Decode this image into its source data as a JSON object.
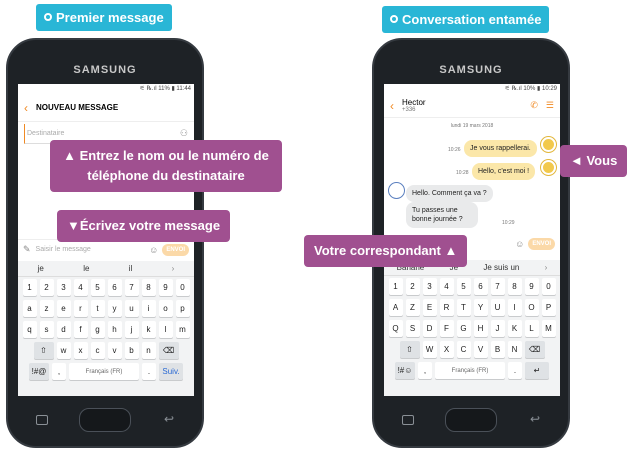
{
  "labels": {
    "first_message": "Premier message",
    "conversation_started": "Conversation entamée",
    "enter_name": "▲ Entrez le nom ou le numéro de téléphone du destinataire",
    "write_message": "▼Écrivez votre message",
    "you": "◄ Vous",
    "correspondent": "Votre correspondant ▲"
  },
  "phone_left": {
    "brand": "SAMSUNG",
    "status": "⚟ ℞.ıl 11% ▮ 11:44",
    "header_title": "NOUVEAU MESSAGE",
    "recipient_placeholder": "Destinataire",
    "input_placeholder": "Saisir le message",
    "send_label": "ENVOI",
    "suggestions": [
      "je",
      "le",
      "il"
    ],
    "keys_row0": [
      "1",
      "2",
      "3",
      "4",
      "5",
      "6",
      "7",
      "8",
      "9",
      "0"
    ],
    "keys_row1": [
      "a",
      "z",
      "e",
      "r",
      "t",
      "y",
      "u",
      "i",
      "o",
      "p"
    ],
    "keys_row2": [
      "q",
      "s",
      "d",
      "f",
      "g",
      "h",
      "j",
      "k",
      "l",
      "m"
    ],
    "keys_row3": [
      "w",
      "x",
      "c",
      "v",
      "b",
      "n"
    ],
    "special": "!#@",
    "comma": ",",
    "language": "Français (FR)",
    "period": ".",
    "next": "Suiv."
  },
  "phone_right": {
    "brand": "SAMSUNG",
    "status": "⚟ ℞.ıl 10% ▮ 10:29",
    "contact_name": "Hector",
    "contact_number": "+336",
    "date": "lundi 19 mars 2018",
    "messages": [
      {
        "text": "Je vous rappellerai.",
        "time": "10:26"
      },
      {
        "text": "Hello, c'est moi !",
        "time": "10:28"
      },
      {
        "text": "Hello. Comment ça va ?",
        "time": ""
      },
      {
        "text": "Tu passes une bonne journée ?",
        "time": "10:29"
      }
    ],
    "send_label": "ENVOI",
    "suggestions": [
      "Banane",
      "Je",
      "Je suis un"
    ],
    "keys_row0": [
      "1",
      "2",
      "3",
      "4",
      "5",
      "6",
      "7",
      "8",
      "9",
      "0"
    ],
    "keys_row1": [
      "A",
      "Z",
      "E",
      "R",
      "T",
      "Y",
      "U",
      "I",
      "O",
      "P"
    ],
    "keys_row2": [
      "Q",
      "S",
      "D",
      "F",
      "G",
      "H",
      "J",
      "K",
      "L",
      "M"
    ],
    "keys_row3": [
      "W",
      "X",
      "C",
      "V",
      "B",
      "N"
    ],
    "special": "!#☺",
    "comma": ",",
    "language": "Français (FR)",
    "period": "."
  }
}
